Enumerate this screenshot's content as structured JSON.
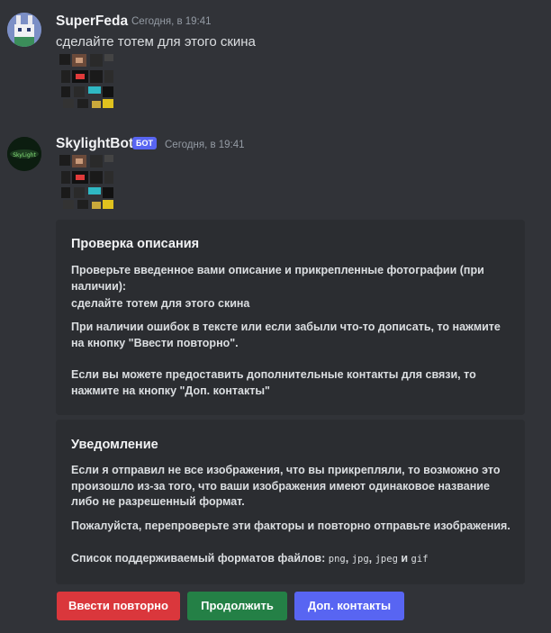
{
  "messages": [
    {
      "username": "SuperFeda",
      "timestamp": "Сегодня, в 19:41",
      "text": "сделайте тотем для этого скина"
    },
    {
      "username": "SkylightBot",
      "bot_tag": "БОТ",
      "timestamp": "Сегодня, в 19:41",
      "avatar_text": "SkyLight"
    }
  ],
  "embeds": [
    {
      "title": "Проверка описания",
      "p1": "Проверьте введенное вами описание и прикрепленные фотографии (при наличии):",
      "p2": "сделайте тотем для этого скина",
      "p3": "При наличии ошибок в тексте или если забыли что-то дописать, то нажмите на кнопку \"Ввести повторно\".",
      "p4": "Если вы можете предоставить дополнительные контакты для связи, то нажмите на кнопку \"Доп. контакты\""
    },
    {
      "title": "Уведомление",
      "p1": "Если я отправил не все изображения, что вы прикрепляли, то возможно это произошло из-за того, что ваши изображения имеют одинаковое название либо не разрешенный формат.",
      "p2": "Пожалуйста, перепроверьте эти факторы и повторно отправьте изображения.",
      "p3_prefix": "Список поддерживаемый форматов файлов:",
      "formats": [
        "png",
        "jpg",
        "jpeg",
        "gif"
      ],
      "sep1": ", ",
      "sep2": ", ",
      "sep3": " и "
    }
  ],
  "buttons": {
    "retry": "Ввести повторно",
    "continue": "Продолжить",
    "contacts": "Доп. контакты"
  },
  "colors": {
    "background": "#313338",
    "embed_background": "#2b2d31",
    "retry_button": "#da373c",
    "continue_button": "#248046",
    "contacts_button": "#5865f2",
    "bot_tag": "#5865f2"
  }
}
